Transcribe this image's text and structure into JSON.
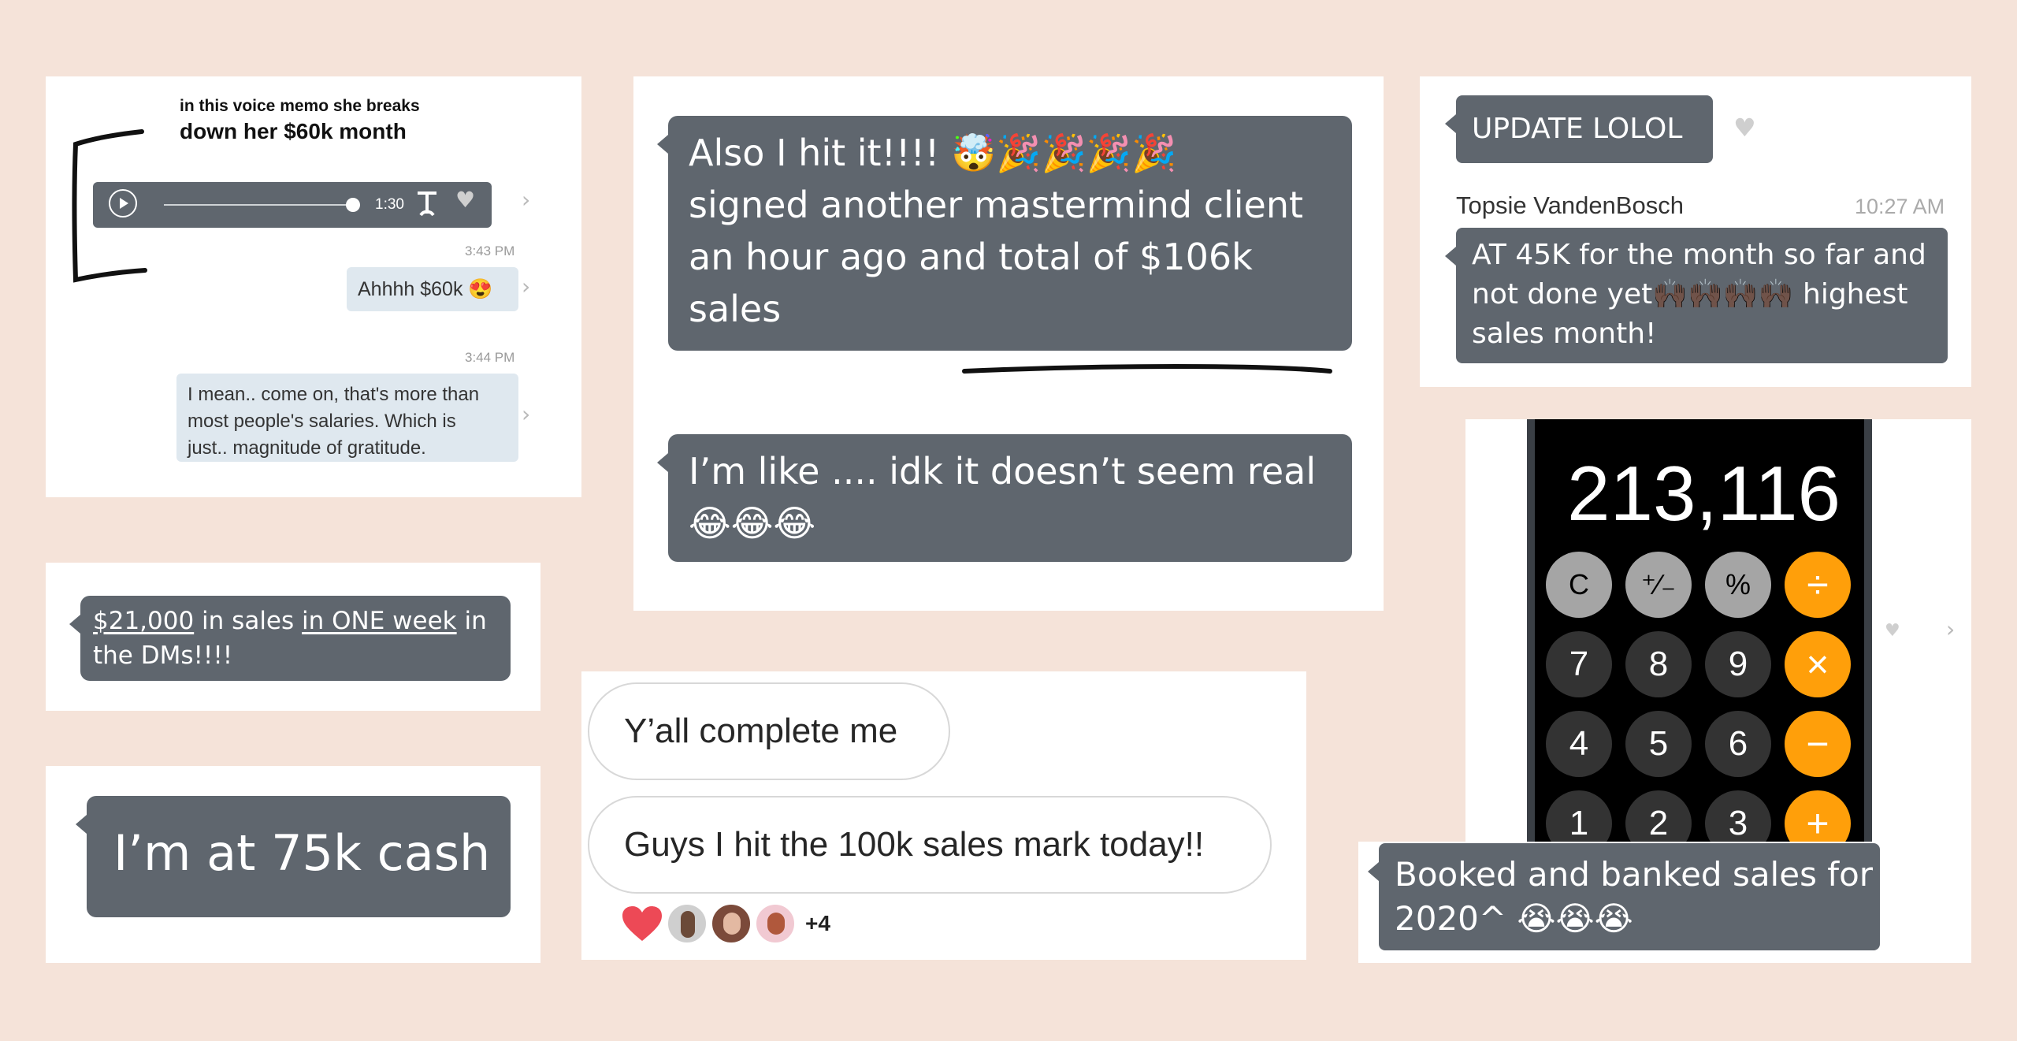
{
  "card1": {
    "caption_line1": "in this voice memo she breaks",
    "caption_line2": "down her $60k month",
    "audio_duration": "1:30",
    "timestamp1": "3:43 PM",
    "message1": "Ahhhh $60k 😍",
    "timestamp2": "3:44 PM",
    "message2_line1": "I mean.. come on, that's more than",
    "message2_line2": "most people's salaries. Which is",
    "message2_line3": "just.. magnitude of gratitude."
  },
  "card2": {
    "amount": "$21,000",
    "text_mid": " in sales ",
    "emph": "in ONE week",
    "text_end": " in",
    "line2": "the DMs!!!!"
  },
  "card3": {
    "message": "I’m at 75k cash"
  },
  "card4": {
    "line1_text": "Also I hit it!!!! ",
    "line1_emoji": "🤯🎉🎉🎉🎉",
    "line2": "signed another mastermind client",
    "line3": "an hour ago and total of $106k",
    "line4": "sales",
    "message2_line1": "I’m like .... idk it doesn’t seem real",
    "message2_line2": "😂😂😂"
  },
  "card5": {
    "message1": "Y’all complete me",
    "message2": "Guys I hit the 100k sales mark today!!",
    "reaction_count": "+4"
  },
  "card6": {
    "message1": "UPDATE LOLOL",
    "sender": "Topsie VandenBosch",
    "time": "10:27 AM",
    "message2_line1": "AT 45K for the month so far and",
    "message2_line2_text": "not done yet",
    "message2_line2_emoji": "🙌🏿🙌🏿🙌🏿🙌🏿",
    "message2_line2_end": " highest",
    "message2_line3": "sales month!"
  },
  "card7": {
    "display": "213,116",
    "buttons": [
      [
        "C",
        "⁺∕₋",
        "%",
        "÷"
      ],
      [
        "7",
        "8",
        "9",
        "×"
      ],
      [
        "4",
        "5",
        "6",
        "−"
      ],
      [
        "1",
        "2",
        "3",
        "+"
      ]
    ],
    "caption_line1": "Booked and banked sales for",
    "caption_line2": "2020^ 😭😭😭"
  },
  "colors": {
    "background": "#f5e3d9",
    "bubble_dark": "#5f666e",
    "bubble_light": "#dfe8ef",
    "heart_red": "#ed4956",
    "calc_orange": "#ff9f0a"
  }
}
